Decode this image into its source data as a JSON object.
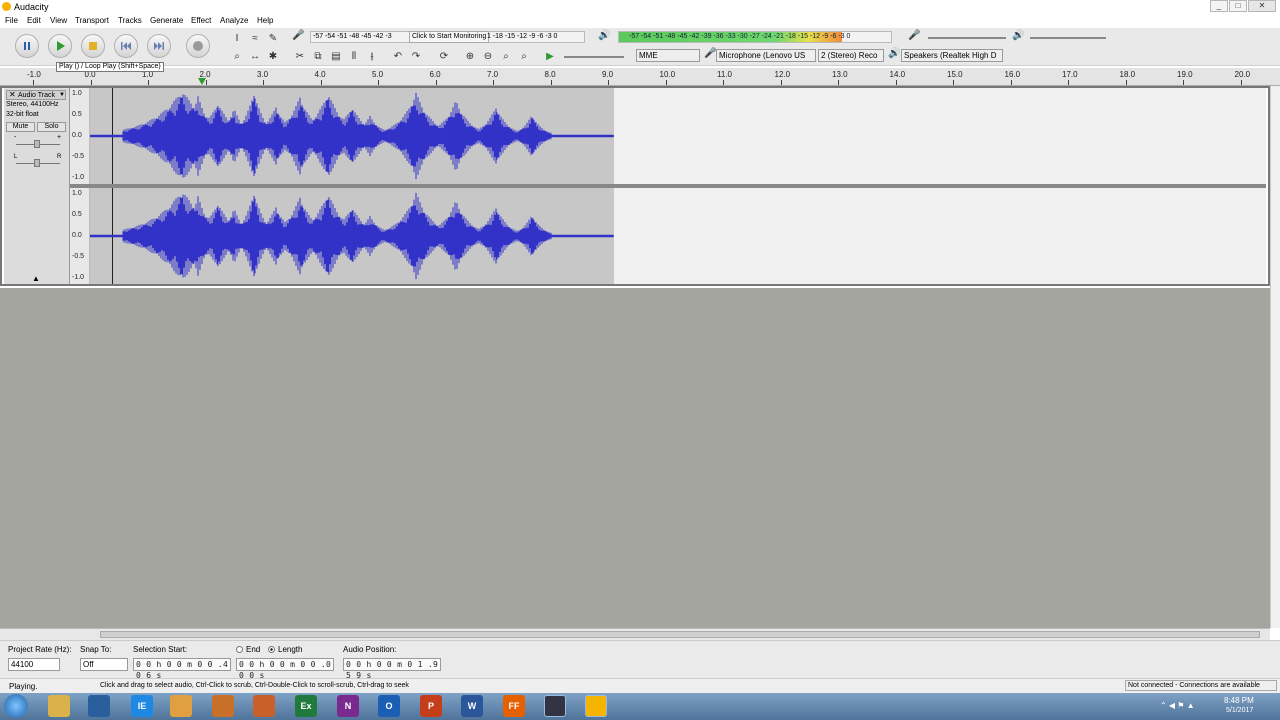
{
  "window": {
    "title": "Audacity",
    "min": "_",
    "max": "□",
    "close": "✕"
  },
  "menu": {
    "file": "File",
    "edit": "Edit",
    "view": "View",
    "transport": "Transport",
    "tracks": "Tracks",
    "generate": "Generate",
    "effect": "Effect",
    "analyze": "Analyze",
    "help": "Help"
  },
  "tooltip": "Play () / Loop Play (Shift+Space)",
  "meters": {
    "rec_scale": "-57 -54 -51 -48 -45 -42 -3",
    "click_monitor": "Click to Start Monitoring",
    "rec_scale_end": "1 -18 -15 -12 -9 -6 -3 0",
    "play_scale": "-57 -54 -51 -48 -45 -42 -39 -36 -33 -30 -27 -24 -21 -18 -15 -12 -9 -6 -3 0",
    "rec_level": 0.78,
    "play_level": 0.82
  },
  "devices": {
    "host": "MME",
    "mic": "Microphone (Lenovo US",
    "channels": "2 (Stereo) Reco",
    "speakers": "Speakers (Realtek High D"
  },
  "ruler": {
    "ticks": [
      "-1.0",
      "0.0",
      "1.0",
      "2.0",
      "3.0",
      "4.0",
      "5.0",
      "6.0",
      "7.0",
      "8.0",
      "9.0",
      "10.0",
      "11.0",
      "12.0",
      "13.0",
      "14.0",
      "15.0",
      "16.0",
      "17.0",
      "18.0",
      "19.0",
      "20.0"
    ]
  },
  "track": {
    "name": "Audio Track",
    "info1": "Stereo, 44100Hz",
    "info2": "32-bit float",
    "mute": "Mute",
    "solo": "Solo",
    "gain_minus": "-",
    "gain_plus": "+",
    "pan_l": "L",
    "pan_r": "R",
    "scale": [
      "1.0",
      "0.5",
      "0.0",
      "-0.5",
      "-1.0"
    ]
  },
  "selbar": {
    "rate_label": "Project Rate (Hz):",
    "rate_value": "44100",
    "snap_label": "Snap To:",
    "snap_value": "Off",
    "start_label": "Selection Start:",
    "start_value": "0 0 h 0 0 m 0 0 .4 0 6 s",
    "end_label": "End",
    "length_label": "Length",
    "length_value": "0 0 h 0 0 m 0 0 .0 0 0 s",
    "pos_label": "Audio Position:",
    "pos_value": "0 0 h 0 0 m 0 1 .9 5 9 s"
  },
  "status": {
    "state": "Playing.",
    "hint": "Click and drag to select audio, Ctrl-Click to scrub, Ctrl-Double-Click to scroll-scrub, Ctrl-drag to seek",
    "connection": "Not connected - Connections are available"
  },
  "taskbar": {
    "time": "8:48 PM",
    "date": "5/1/2017",
    "apps": [
      "IE",
      "Ex",
      "W",
      "P",
      "O",
      "N",
      "FF"
    ]
  }
}
